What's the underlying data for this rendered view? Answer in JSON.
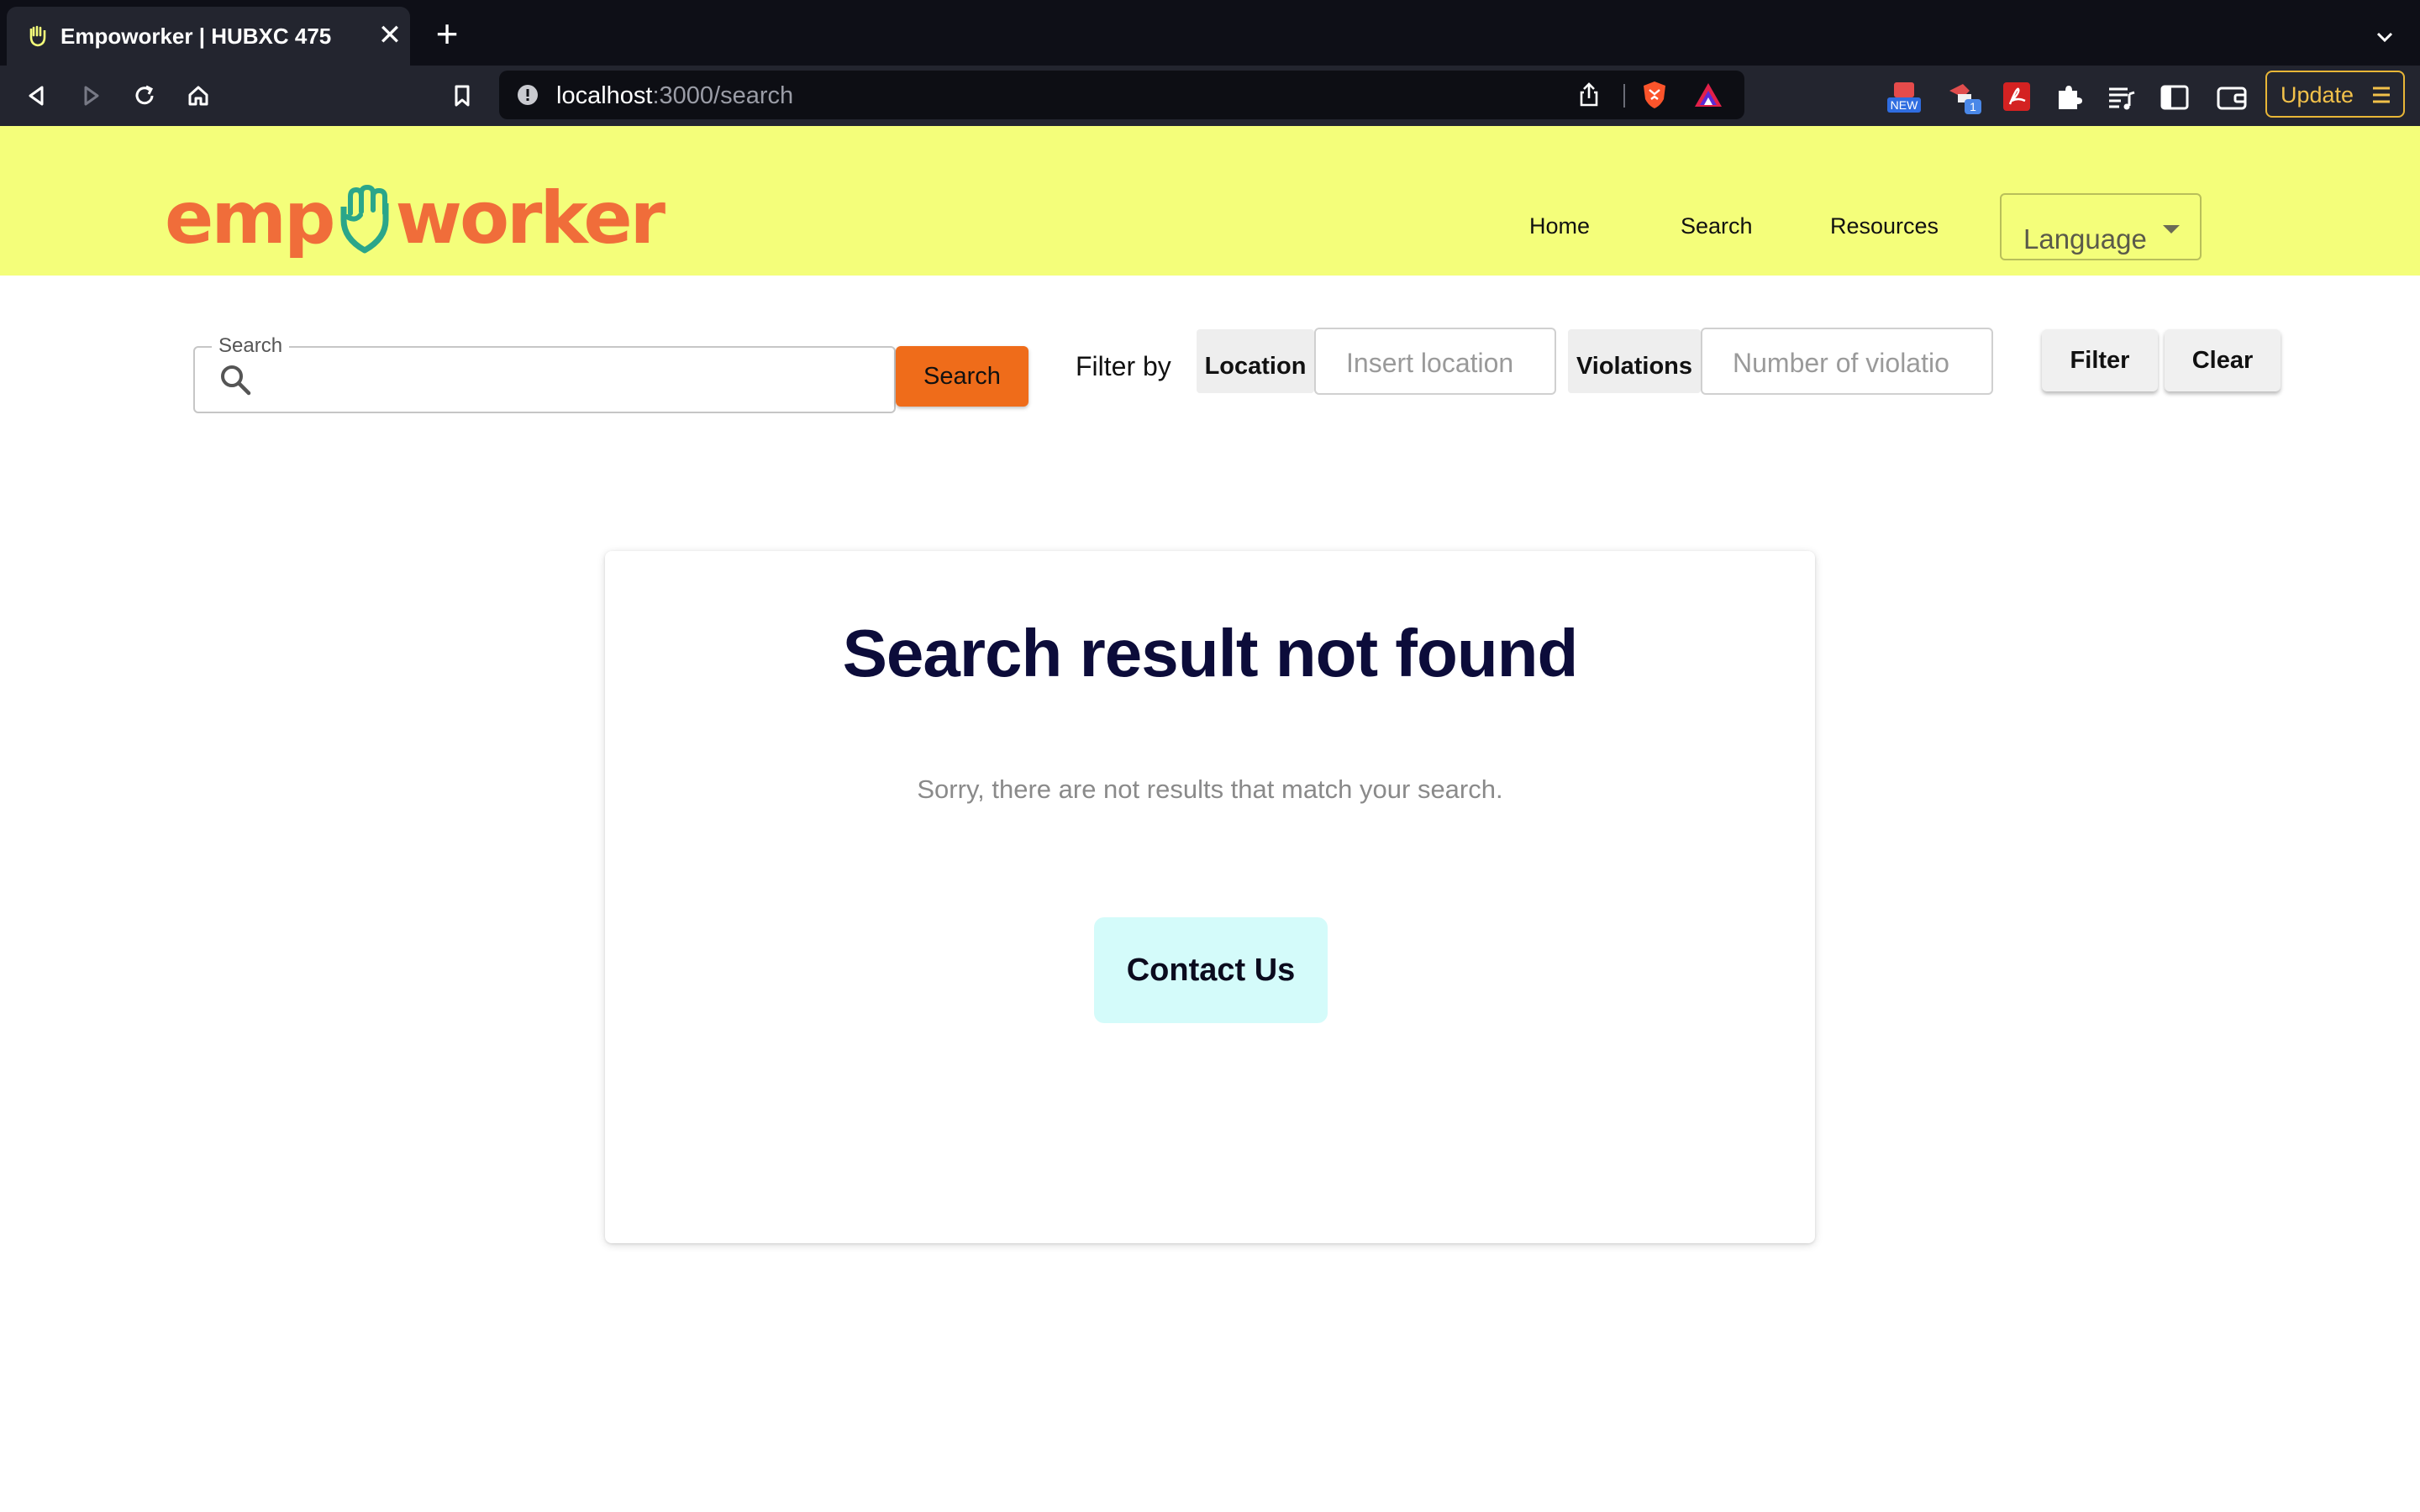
{
  "browser": {
    "tab": {
      "title": "Empoworker | HUBXC 475",
      "close_label": "✕"
    },
    "new_tab_label": "+",
    "url": {
      "host": "localhost",
      "path": ":3000/search"
    },
    "extensions": {
      "new_badge": "NEW",
      "count_badge": "1"
    },
    "update_label": "Update"
  },
  "site": {
    "logo": {
      "part1": "emp",
      "part2": "worker",
      "brand_color": "#f06d3a",
      "fist_color": "#2aa68a"
    },
    "nav": [
      {
        "label": "Home"
      },
      {
        "label": "Search"
      },
      {
        "label": "Resources"
      }
    ],
    "language_label": "Language",
    "header_color": "#f4fe7a"
  },
  "search": {
    "legend": "Search",
    "value": "",
    "button_label": "Search",
    "button_color": "#ef6c1a"
  },
  "filters": {
    "label": "Filter by",
    "location": {
      "tag": "Location",
      "placeholder": "Insert location"
    },
    "violations": {
      "tag": "Violations",
      "placeholder": "Number of violatio"
    },
    "filter_button": "Filter",
    "clear_button": "Clear"
  },
  "result": {
    "title": "Search result not found",
    "message": "Sorry, there are not results that match your search.",
    "contact_label": "Contact Us",
    "contact_color": "#d4fbfa"
  }
}
